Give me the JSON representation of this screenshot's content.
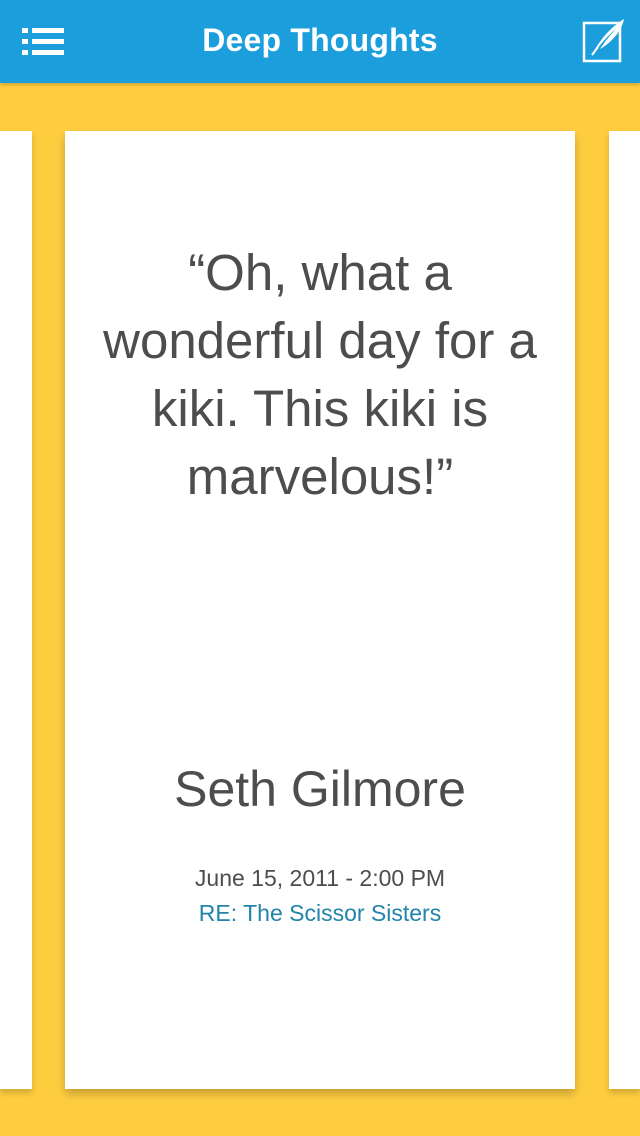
{
  "navbar": {
    "title": "Deep Thoughts",
    "menu_icon": "list-menu-icon",
    "compose_icon": "quill-compose-icon"
  },
  "card": {
    "quote": "“Oh, what a wonderful day for a kiki.  This kiki is marvelous!”",
    "author": "Seth Gilmore",
    "date": "June 15, 2011 - 2:00 PM",
    "subject": "RE: The Scissor Sisters"
  },
  "colors": {
    "navbar": "#1c9edc",
    "background": "#fecd3f",
    "card": "#ffffff",
    "text": "#4d4d4d",
    "link": "#2184a8"
  }
}
